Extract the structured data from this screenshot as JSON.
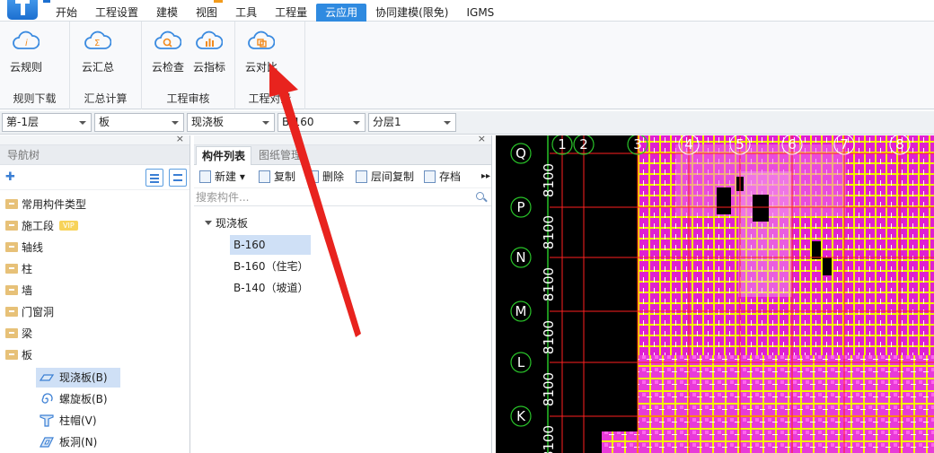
{
  "menu": {
    "tabs": [
      "开始",
      "工程设置",
      "建模",
      "视图",
      "工具",
      "工程量",
      "云应用",
      "协同建模(限免)",
      "IGMS"
    ],
    "active_tab": "云应用"
  },
  "ribbon": {
    "groups": [
      {
        "label": "规则下载",
        "buttons": [
          {
            "label": "云规则",
            "icon": "cloud-info-icon"
          }
        ]
      },
      {
        "label": "汇总计算",
        "buttons": [
          {
            "label": "云汇总",
            "icon": "cloud-sum-icon"
          }
        ]
      },
      {
        "label": "工程审核",
        "buttons": [
          {
            "label": "云检查",
            "icon": "cloud-search-icon"
          },
          {
            "label": "云指标",
            "icon": "cloud-chart-icon"
          }
        ]
      },
      {
        "label": "工程对量",
        "buttons": [
          {
            "label": "云对比",
            "icon": "cloud-compare-icon"
          }
        ]
      }
    ]
  },
  "property_bar": {
    "floor": "第-1层",
    "category": "板",
    "type": "现浇板",
    "component": "B-160",
    "layer": "分层1"
  },
  "nav_tree": {
    "title": "导航树",
    "items": [
      {
        "label": "常用构件类型"
      },
      {
        "label": "施工段",
        "badge": "VIP"
      },
      {
        "label": "轴线"
      },
      {
        "label": "柱"
      },
      {
        "label": "墙"
      },
      {
        "label": "门窗洞"
      },
      {
        "label": "梁"
      },
      {
        "label": "板"
      }
    ],
    "sub_items": [
      {
        "label": "现浇板(B)",
        "icon": "slab-icon",
        "selected": true
      },
      {
        "label": "螺旋板(B)",
        "icon": "spiral-slab-icon"
      },
      {
        "label": "柱帽(V)",
        "icon": "column-cap-icon"
      },
      {
        "label": "板洞(N)",
        "icon": "slab-hole-icon"
      }
    ]
  },
  "component_list": {
    "tabs": [
      "构件列表",
      "图纸管理"
    ],
    "toolbar": [
      "新建",
      "复制",
      "删除",
      "层间复制",
      "存档"
    ],
    "search_placeholder": "搜索构件...",
    "group": "现浇板",
    "items": [
      "B-160",
      "B-160（住宅）",
      "B-140（坡道）"
    ],
    "selected": "B-160"
  },
  "canvas": {
    "row_axes": [
      "Q",
      "P",
      "N",
      "M",
      "L",
      "K"
    ],
    "col_axes": [
      "1",
      "2",
      "3",
      "4",
      "5",
      "6",
      "7",
      "8"
    ],
    "spacings": [
      "8100",
      "8100",
      "8100",
      "8100",
      "8100",
      "8100"
    ],
    "colors": {
      "slab": "#e020d0",
      "rebar": "#f2f200",
      "grid": "#ff2020",
      "axis_line": "#29c229"
    }
  }
}
